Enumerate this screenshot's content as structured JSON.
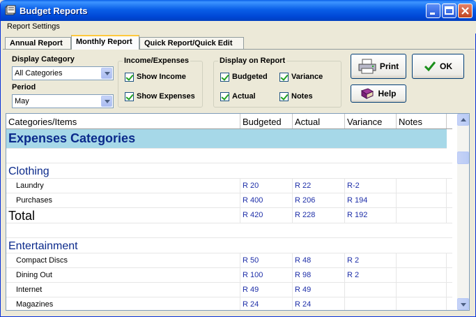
{
  "window": {
    "title": "Budget Reports"
  },
  "menu": {
    "report_settings": "Report Settings"
  },
  "tabs": [
    {
      "label": "Annual Report"
    },
    {
      "label": "Monthly Report"
    },
    {
      "label": "Quick Report/Quick Edit"
    }
  ],
  "filters": {
    "display_category_label": "Display Category",
    "display_category_value": "All Categories",
    "period_label": "Period",
    "period_value": "May"
  },
  "income_expenses": {
    "title": "Income/Expenses",
    "show_income": "Show Income",
    "show_expenses": "Show Expenses"
  },
  "display_on_report": {
    "title": "Display on Report",
    "budgeted": "Budgeted",
    "variance": "Variance",
    "actual": "Actual",
    "notes": "Notes"
  },
  "buttons": {
    "print": "Print",
    "ok": "OK",
    "help": "Help"
  },
  "table": {
    "headers": [
      "Categories/Items",
      "Budgeted",
      "Actual",
      "Variance",
      "Notes"
    ],
    "section": "Expenses Categories",
    "clothing": {
      "name": "Clothing",
      "rows": [
        {
          "item": "Laundry",
          "budgeted": "R 20",
          "actual": "R 22",
          "variance": "R-2",
          "notes": ""
        },
        {
          "item": "Purchases",
          "budgeted": "R 400",
          "actual": "R 206",
          "variance": "R 194",
          "notes": ""
        }
      ],
      "total": {
        "label": "Total",
        "budgeted": "R 420",
        "actual": "R 228",
        "variance": "R 192"
      }
    },
    "entertainment": {
      "name": "Entertainment",
      "rows": [
        {
          "item": "Compact Discs",
          "budgeted": "R 50",
          "actual": "R 48",
          "variance": "R 2",
          "notes": ""
        },
        {
          "item": "Dining Out",
          "budgeted": "R 100",
          "actual": "R 98",
          "variance": "R 2",
          "notes": ""
        },
        {
          "item": "Internet",
          "budgeted": "R 49",
          "actual": "R 49",
          "variance": "",
          "notes": ""
        },
        {
          "item": "Magazines",
          "budgeted": "R 24",
          "actual": "R 24",
          "variance": "",
          "notes": ""
        }
      ]
    }
  }
}
